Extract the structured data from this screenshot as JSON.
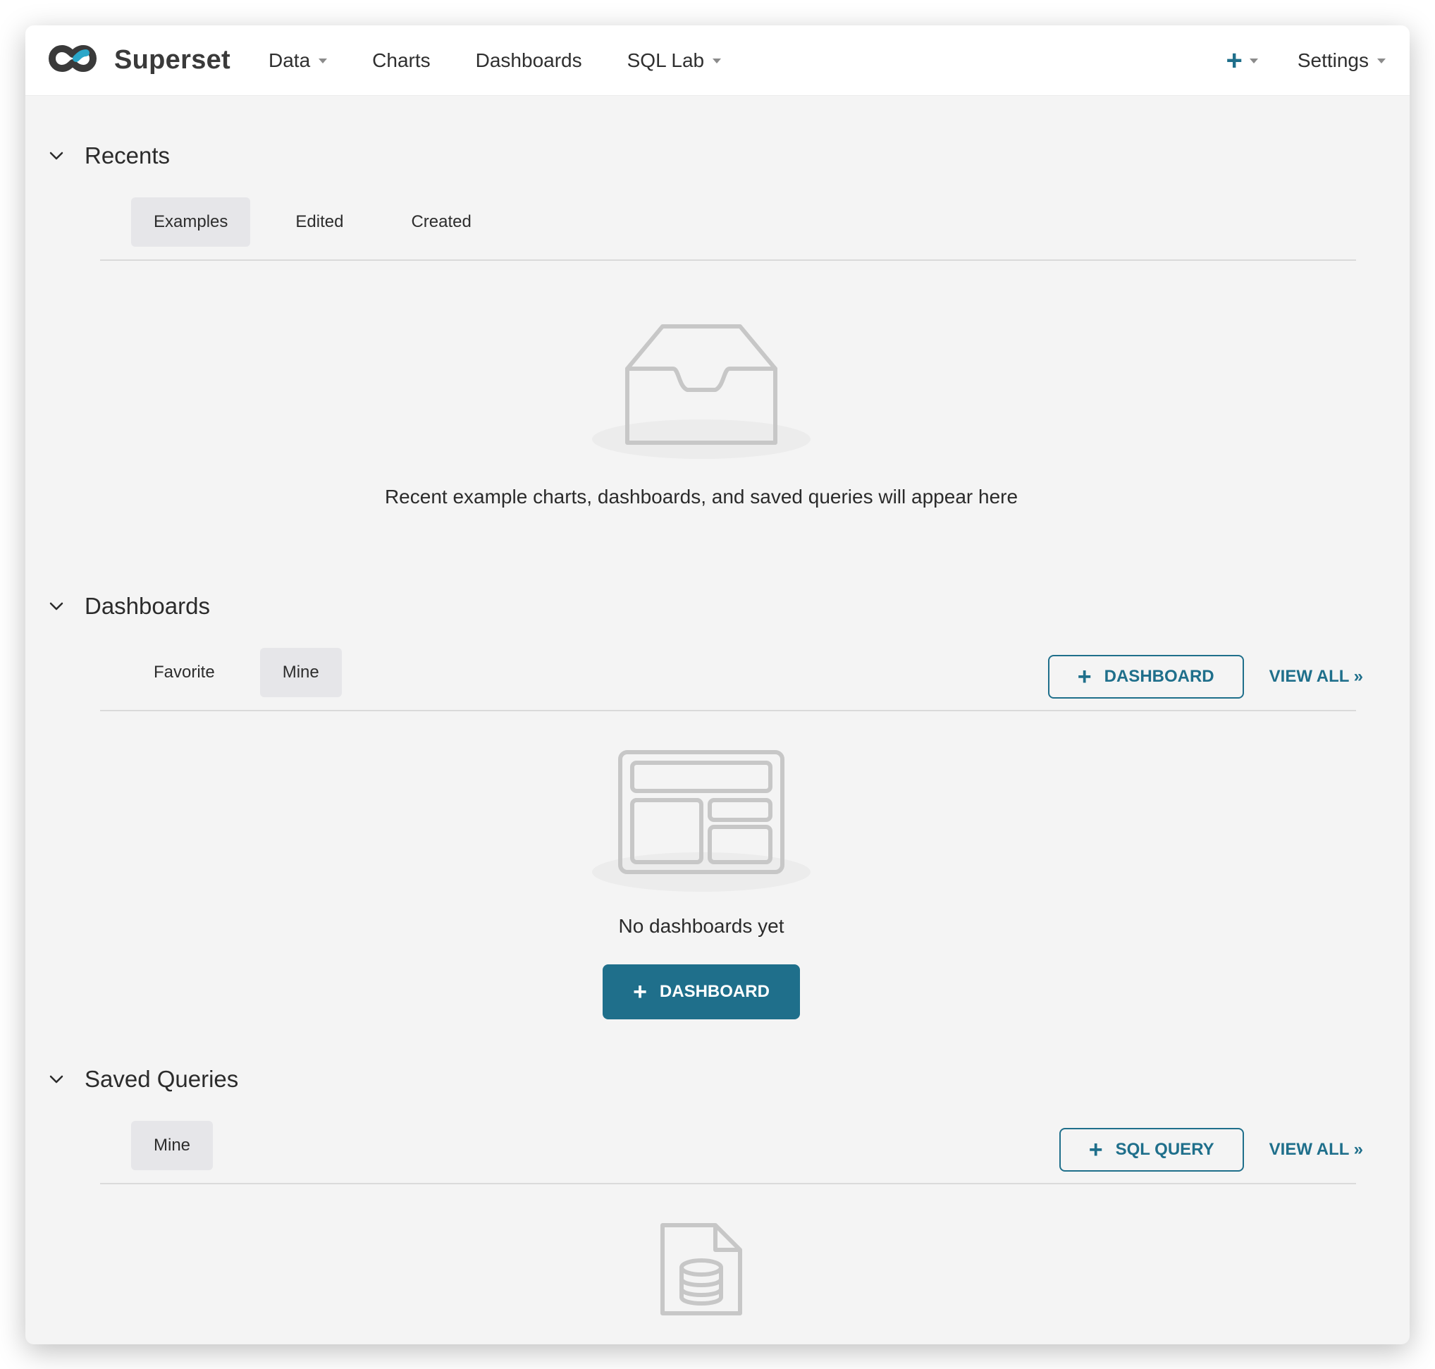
{
  "app": {
    "brand_name": "Superset"
  },
  "nav": {
    "items": [
      {
        "label": "Data",
        "has_caret": true
      },
      {
        "label": "Charts",
        "has_caret": false
      },
      {
        "label": "Dashboards",
        "has_caret": false
      },
      {
        "label": "SQL Lab",
        "has_caret": true
      }
    ],
    "right": {
      "plus_label": "+",
      "settings_label": "Settings"
    }
  },
  "sections": {
    "recents": {
      "title": "Recents",
      "tabs": [
        {
          "label": "Examples",
          "active": true
        },
        {
          "label": "Edited",
          "active": false
        },
        {
          "label": "Created",
          "active": false
        }
      ],
      "empty_text": "Recent example charts, dashboards, and saved queries will appear here"
    },
    "dashboards": {
      "title": "Dashboards",
      "tabs": [
        {
          "label": "Favorite",
          "active": false
        },
        {
          "label": "Mine",
          "active": true
        }
      ],
      "actions": {
        "add_label": "DASHBOARD",
        "view_all_label": "VIEW ALL »"
      },
      "empty_text": "No dashboards yet",
      "empty_button_label": "DASHBOARD"
    },
    "saved_queries": {
      "title": "Saved Queries",
      "tabs": [
        {
          "label": "Mine",
          "active": true
        }
      ],
      "actions": {
        "add_label": "SQL QUERY",
        "view_all_label": "VIEW ALL »"
      }
    }
  },
  "colors": {
    "accent": "#1f6f8b",
    "background": "#f4f4f4",
    "tab_active_bg": "#e6e6e9"
  },
  "icons": {
    "brand": "superset-logo-icon",
    "collapse": "chevron-down-icon",
    "plus": "plus-icon",
    "empty_recents": "empty-inbox-icon",
    "empty_dashboards": "empty-dashboard-icon",
    "empty_queries": "empty-query-icon"
  }
}
